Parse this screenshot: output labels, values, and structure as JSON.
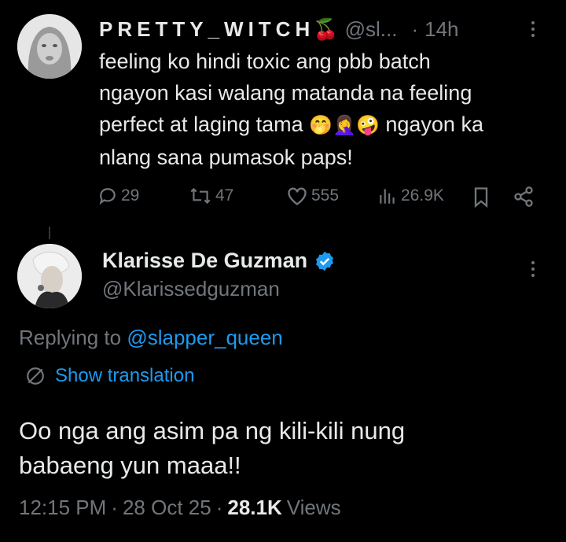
{
  "parent_tweet": {
    "display_name": "PRETTY_WITCH",
    "name_emoji": "🍒",
    "handle": "@sl...",
    "separator": "·",
    "time": "14h",
    "text_lines": [
      "feeling ko hindi toxic ang pbb batch",
      "ngayon kasi walang matanda na feeling",
      "perfect at laging tama",
      "ngayon ka",
      "nlang sana pumasok paps!"
    ],
    "emojis": [
      "🤭",
      "🤦‍♀️",
      "🤪"
    ],
    "actions": {
      "replies": "29",
      "reposts": "47",
      "likes": "555",
      "views": "26.9K"
    }
  },
  "main_tweet": {
    "display_name": "Klarisse De Guzman",
    "handle": "@Klarissedguzman",
    "replying_prefix": "Replying to ",
    "replying_to": "@slapper_queen",
    "show_translation": "Show translation",
    "text_lines": [
      "Oo nga ang asim pa ng kili-kili nung",
      "babaeng yun maaa!!"
    ],
    "time": "12:15 PM",
    "separator": "·",
    "date": "28 Oct 25",
    "separator2": "·",
    "views_count": "28.1K",
    "views_label": "Views"
  },
  "colors": {
    "background": "#000000",
    "text": "#e7e9ea",
    "muted": "#71767b",
    "link": "#1d9bf0",
    "verified": "#1d9bf0"
  }
}
